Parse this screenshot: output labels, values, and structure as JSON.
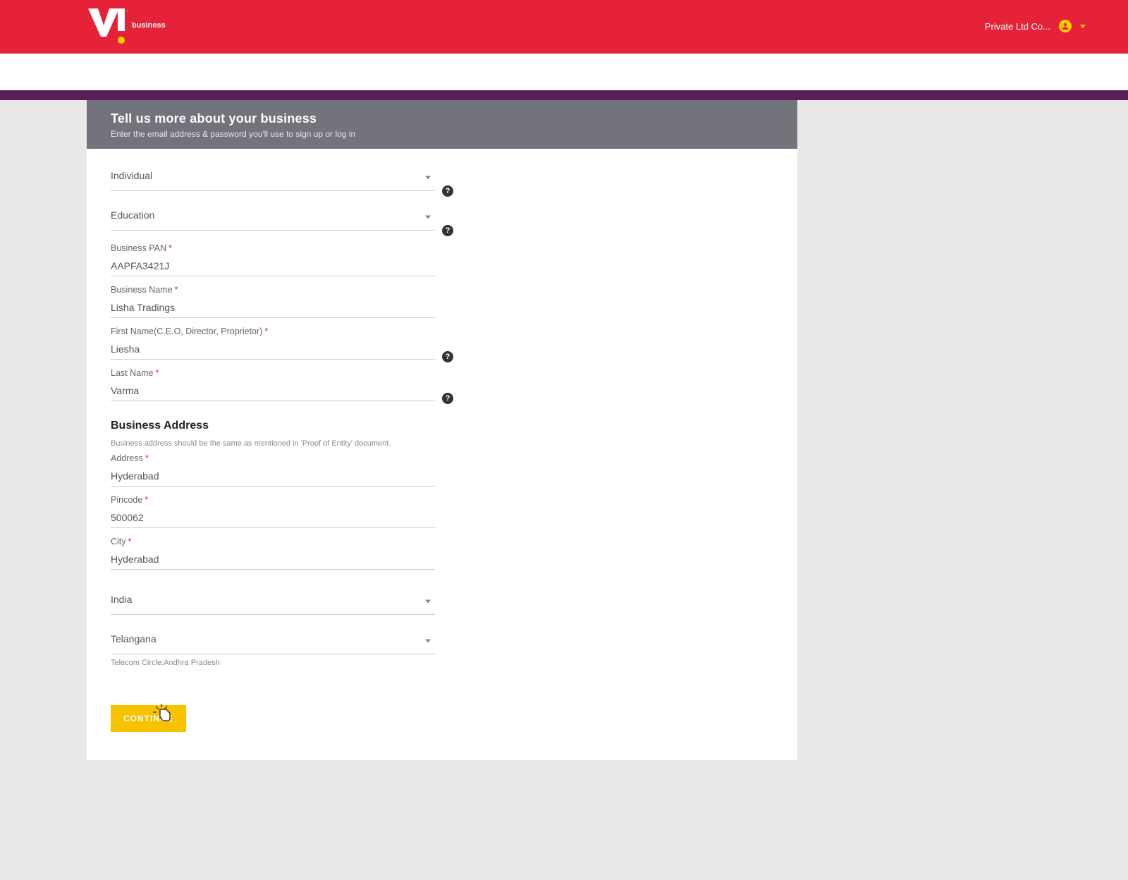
{
  "header": {
    "brand_sub": "business",
    "account_label": "Private Ltd Co..."
  },
  "page": {
    "title": "Tell us more about your business",
    "subtitle": "Enter the email address & password you'll use to sign up or log in"
  },
  "form": {
    "entity_type": {
      "value": "Individual"
    },
    "category": {
      "value": "Education"
    },
    "pan": {
      "label": "Business PAN",
      "required": true,
      "value": "AAPFA3421J"
    },
    "biz_name": {
      "label": "Business Name",
      "required": true,
      "value": "Lisha Tradings"
    },
    "first_name": {
      "label": "First Name(C.E.O, Director, Proprietor)",
      "required": true,
      "value": "Liesha"
    },
    "last_name": {
      "label": "Last Name",
      "required": true,
      "value": "Varma"
    },
    "section_address_title": "Business Address",
    "section_address_note": "Business address should be the same as mentioned in 'Proof of Entity' document.",
    "address": {
      "label": "Address",
      "required": true,
      "value": "Hyderabad"
    },
    "pincode": {
      "label": "Pincode",
      "required": true,
      "value": "500062"
    },
    "city": {
      "label": "City",
      "required": true,
      "value": "Hyderabad"
    },
    "country": {
      "value": "India"
    },
    "state": {
      "value": "Telangana"
    },
    "telecom_circle": "Telecom Circle:Andhra Pradesh",
    "continue_label": "CONTINUE"
  }
}
